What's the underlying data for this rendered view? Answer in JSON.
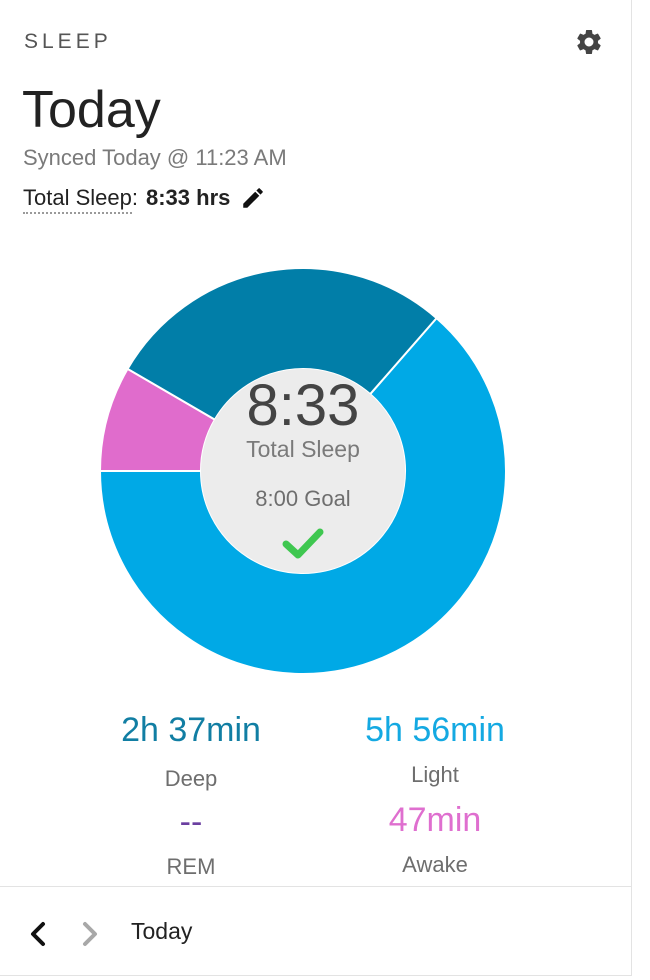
{
  "header": {
    "section_label": "SLEEP",
    "title": "Today",
    "synced": "Synced Today @ 11:23 AM",
    "total_label": "Total Sleep",
    "total_colon": ":",
    "total_value": "8:33 hrs",
    "settings_icon": "gear-icon",
    "edit_icon": "pencil-icon"
  },
  "donut": {
    "center_time": "8:33",
    "center_label": "Total Sleep",
    "goal_text": "8:00 Goal",
    "goal_met_icon": "checkmark-icon",
    "segments": [
      {
        "name": "Light",
        "minutes": 356,
        "color": "#00a9e6"
      },
      {
        "name": "Awake",
        "minutes": 47,
        "color": "#e06ccc"
      },
      {
        "name": "Deep",
        "minutes": 157,
        "color": "#017ea8"
      }
    ],
    "center_color": "#ececec"
  },
  "stats": {
    "deep": {
      "value": "2h 37min",
      "label": "Deep",
      "color": "#117ea3"
    },
    "light": {
      "value": "5h 56min",
      "label": "Light",
      "color": "#14a9e2"
    },
    "rem": {
      "value": "--",
      "label": "REM",
      "color": "#6b3fa0"
    },
    "awake": {
      "value": "47min",
      "label": "Awake",
      "color": "#df6fcf"
    }
  },
  "footer": {
    "date_label": "Today",
    "prev_icon": "chevron-left-icon",
    "next_icon": "chevron-right-icon"
  }
}
